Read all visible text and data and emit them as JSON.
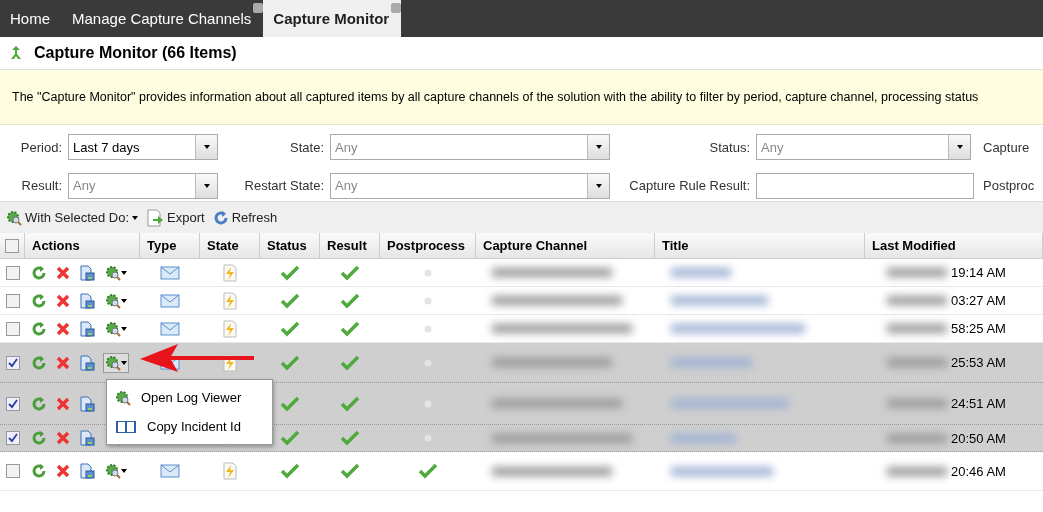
{
  "tabs": [
    {
      "label": "Home",
      "selected": false,
      "closable": false
    },
    {
      "label": "Manage Capture Channels",
      "selected": false,
      "closable": true
    },
    {
      "label": "Capture Monitor",
      "selected": true,
      "closable": true
    }
  ],
  "page_title": "Capture Monitor (66 Items)",
  "info": "The \"Capture Monitor\" provides information about all captured items by all capture channels of the solution with the ability to filter by period, capture channel, processing status",
  "filters": [
    {
      "label": "Period:",
      "kind": "select",
      "value": "Last 7 days"
    },
    {
      "label": "State:",
      "kind": "select",
      "placeholder": "Any"
    },
    {
      "label": "Status:",
      "kind": "select",
      "placeholder": "Any"
    },
    {
      "label": "Capture",
      "kind": "cut"
    },
    {
      "label": "Result:",
      "kind": "select",
      "placeholder": "Any"
    },
    {
      "label": "Restart State:",
      "kind": "select",
      "placeholder": "Any"
    },
    {
      "label": "Capture Rule Result:",
      "kind": "text"
    },
    {
      "label": "Postproc",
      "kind": "cut"
    }
  ],
  "toolbar": [
    {
      "label": "With Selected Do:",
      "kind": "menu"
    },
    {
      "label": "Export",
      "kind": "export"
    },
    {
      "label": "Refresh",
      "kind": "refresh"
    }
  ],
  "table": {
    "columns": [
      "Actions",
      "Type",
      "State",
      "Status",
      "Result",
      "Postprocess",
      "Capture Channel",
      "Title",
      "Last Modified"
    ],
    "header_checked": false,
    "rows": [
      {
        "checked": false,
        "status_ok": true,
        "result_ok": true,
        "postprocess_done": false,
        "time": "19:14 AM"
      },
      {
        "checked": false,
        "status_ok": true,
        "result_ok": true,
        "postprocess_done": false,
        "time": "03:27 AM"
      },
      {
        "checked": false,
        "status_ok": true,
        "result_ok": true,
        "postprocess_done": false,
        "time": "58:25 AM"
      },
      {
        "checked": true,
        "status_ok": true,
        "result_ok": true,
        "postprocess_done": false,
        "time": "25:53 AM"
      },
      {
        "checked": true,
        "status_ok": true,
        "result_ok": true,
        "postprocess_done": false,
        "time": "24:51 AM"
      },
      {
        "checked": true,
        "status_ok": true,
        "result_ok": true,
        "postprocess_done": false,
        "time": "20:50 AM"
      },
      {
        "checked": false,
        "status_ok": true,
        "result_ok": true,
        "postprocess_done": true,
        "time": "20:46 AM"
      }
    ]
  },
  "context_menu": {
    "items": [
      {
        "label": "Open Log Viewer",
        "kind": "log"
      },
      {
        "label": "Copy Incident Id",
        "kind": "book"
      }
    ]
  }
}
